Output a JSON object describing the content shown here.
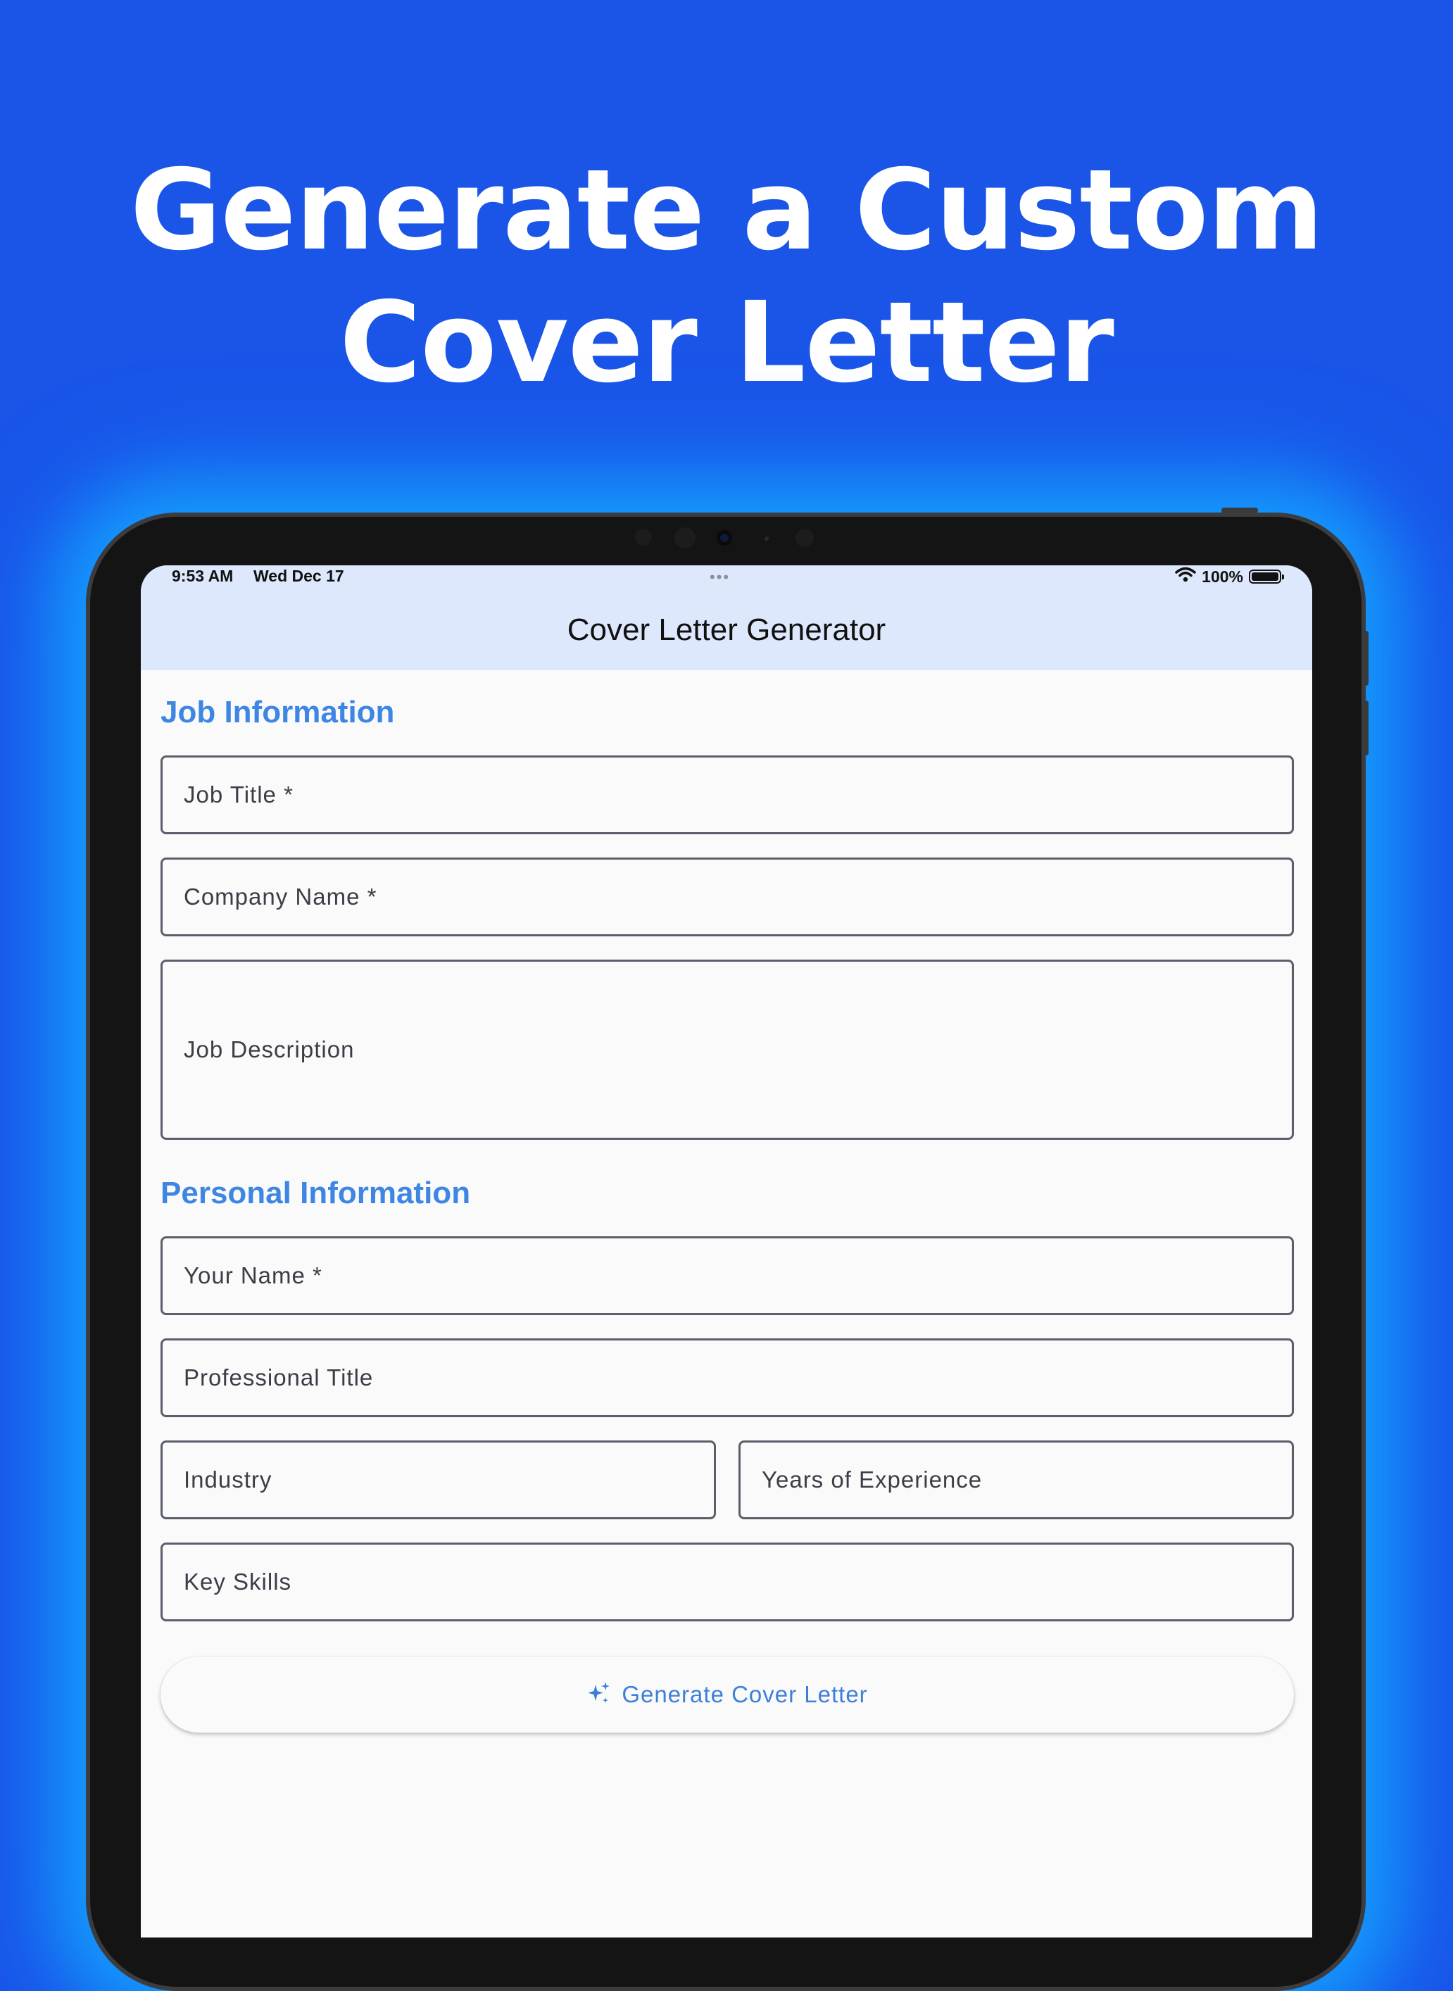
{
  "headline": {
    "line1": "Generate a Custom",
    "line2": "Cover Letter"
  },
  "status_bar": {
    "time": "9:53 AM",
    "date": "Wed Dec 17",
    "dots": "•••",
    "battery": "100%"
  },
  "app_bar": {
    "title": "Cover Letter Generator"
  },
  "sections": {
    "job": "Job Information",
    "personal": "Personal Information"
  },
  "fields": {
    "job_title": "Job Title *",
    "company_name": "Company Name *",
    "job_description": "Job Description",
    "your_name": "Your Name *",
    "professional_title": "Professional Title",
    "industry": "Industry",
    "years_experience": "Years of Experience",
    "key_skills": "Key Skills"
  },
  "actions": {
    "generate": "Generate Cover Letter"
  },
  "colors": {
    "background": "#1a55e8",
    "app_bar": "#dde8fd",
    "accent": "#3e86e3"
  },
  "icons": {
    "generate": "sparkle-icon",
    "wifi": "wifi-icon",
    "battery": "battery-icon"
  }
}
